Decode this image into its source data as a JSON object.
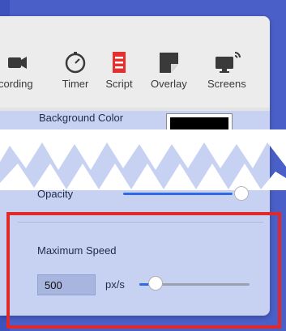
{
  "toolbar": {
    "items": [
      {
        "label": "cording",
        "icon": "video-camera-icon"
      },
      {
        "label": "Timer",
        "icon": "stopwatch-icon"
      },
      {
        "label": "Script",
        "icon": "script-document-icon"
      },
      {
        "label": "Overlay",
        "icon": "overlay-icon"
      },
      {
        "label": "Screens",
        "icon": "screens-icon"
      }
    ]
  },
  "settings": {
    "background_color_label": "Background Color",
    "background_color_value": "#000000",
    "opacity_label": "Opacity",
    "opacity_level": 1.0,
    "max_speed_label": "Maximum Speed",
    "max_speed_value": "500",
    "max_speed_unit": "px/s",
    "max_speed_slider_fraction": 0.15
  },
  "colors": {
    "accent": "#2e6ae6",
    "script_icon": "#e53030",
    "highlight": "#e02a2a"
  }
}
